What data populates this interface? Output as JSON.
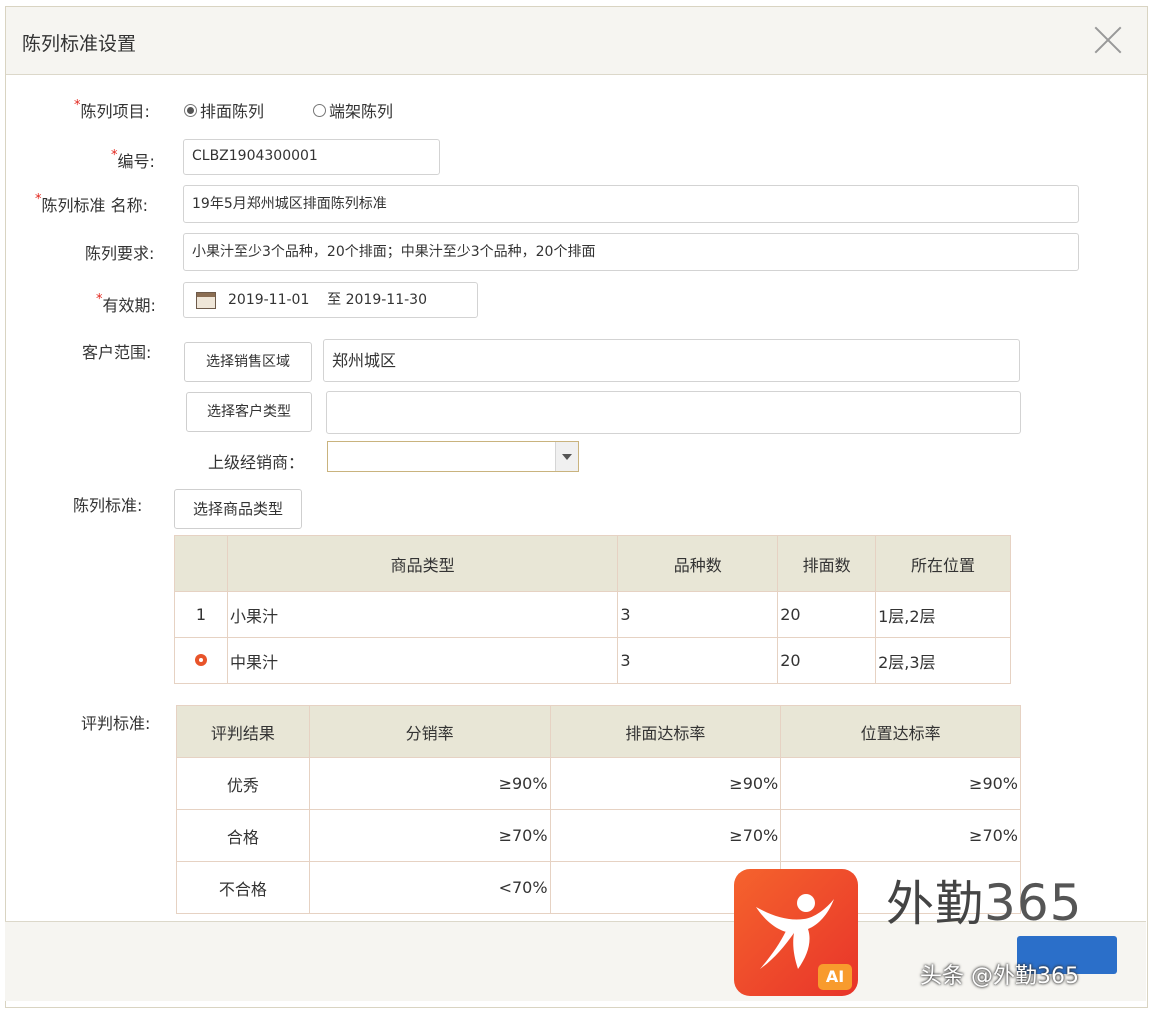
{
  "dialog": {
    "title": "陈列标准设置"
  },
  "form": {
    "project_label": "陈列项目:",
    "project_options": [
      "排面陈列",
      "端架陈列"
    ],
    "code_label": "编号:",
    "code_value": "CLBZ1904300001",
    "name_label": "陈列标准 名称:",
    "name_value": "19年5月郑州城区排面陈列标准",
    "requirement_label": "陈列要求:",
    "requirement_value": "小果汁至少3个品种，20个排面；中果汁至少3个品种，20个排面",
    "validity_label": "有效期:",
    "validity_value": "2019-11-01    至 2019-11-30",
    "customer_label": "客户范围:",
    "select_region_button": "选择销售区域",
    "region_value": "郑州城区",
    "select_customer_type_button": "选择客户类型",
    "customer_type_value": "",
    "dealer_label": "上级经销商：",
    "standard_label": "陈列标准:",
    "select_product_type_button": "选择商品类型"
  },
  "display_table": {
    "headers": [
      "",
      "商品类型",
      "品种数",
      "排面数",
      "所在位置"
    ],
    "rows": [
      {
        "index": "1",
        "product": "小果汁",
        "varieties": "3",
        "facings": "20",
        "location": "1层,2层",
        "selected": false
      },
      {
        "index": "",
        "product": "中果汁",
        "varieties": "3",
        "facings": "20",
        "location": "2层,3层",
        "selected": true
      }
    ]
  },
  "evaluation": {
    "label": "评判标准:",
    "headers": [
      "评判结果",
      "分销率",
      "排面达标率",
      "位置达标率"
    ],
    "rows": [
      [
        "优秀",
        "≥90%",
        "≥90%",
        "≥90%"
      ],
      [
        "合格",
        "≥70%",
        "≥70%",
        "≥70%"
      ],
      [
        "不合格",
        "<70%",
        "",
        ""
      ]
    ]
  },
  "watermark": {
    "brand": "外勤",
    "brand_num": "365",
    "ai_badge": "AI",
    "handle": "头条 @外勤365"
  },
  "colors": {
    "required": "#e2231a",
    "table_header": "#e8e6d6",
    "selected_dot": "#e8542a",
    "confirm": "#2b6fc9"
  }
}
